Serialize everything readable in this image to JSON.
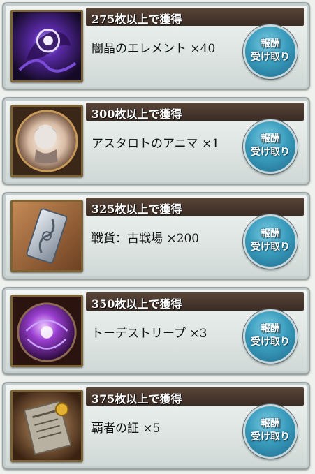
{
  "rewards": [
    {
      "header": "275枚以上で獲得",
      "item": "闇晶のエレメント ×40",
      "thumb_icon": "dark-element-icon",
      "claim_label": "報酬\n受け取り"
    },
    {
      "header": "300枚以上で獲得",
      "item": "アスタロトのアニマ ×1",
      "thumb_icon": "astaroth-anima-icon",
      "claim_label": "報酬\n受け取り"
    },
    {
      "header": "325枚以上で獲得",
      "item": "戦貨：古戦場 ×200",
      "thumb_icon": "war-token-icon",
      "claim_label": "報酬\n受け取り"
    },
    {
      "header": "350枚以上で獲得",
      "item": "トーデストリープ ×3",
      "thumb_icon": "todestrieb-orb-icon",
      "claim_label": "報酬\n受け取り"
    },
    {
      "header": "375枚以上で獲得",
      "item": "覇者の証 ×5",
      "thumb_icon": "champion-proof-icon",
      "claim_label": "報酬\n受け取り"
    }
  ],
  "colors": {
    "header_bg": "#3a2c24",
    "claim_button": "#3a9cbd",
    "card_bg": "#dfe6e4"
  }
}
